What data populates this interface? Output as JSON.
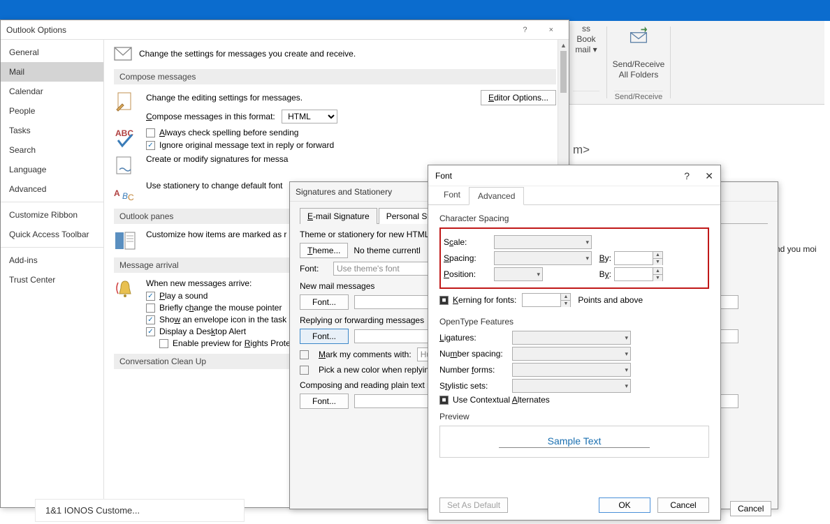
{
  "ribbon": {
    "addr_book": "ss Book",
    "addr_email": "mail ▾",
    "send_receive_top": "Send/Receive",
    "send_receive_bottom": "All Folders",
    "send_receive_group": "Send/Receive"
  },
  "background": {
    "angle_text": "m>",
    "help_q": "?",
    "close_x": "×",
    "truncated": "nd you moi"
  },
  "options": {
    "title": "Outlook Options",
    "nav": [
      "General",
      "Mail",
      "Calendar",
      "People",
      "Tasks",
      "Search",
      "Language",
      "Advanced",
      "Customize Ribbon",
      "Quick Access Toolbar",
      "Add-ins",
      "Trust Center"
    ],
    "header": "Change the settings for messages you create and receive.",
    "sec_compose": "Compose messages",
    "compose_edit": "Change the editing settings for messages.",
    "editor_btn": "Editor Options...",
    "compose_fmt": "Compose messages in this format:",
    "compose_fmt_val": "HTML",
    "chk_spell": "Always check spelling before sending",
    "chk_ignore": "Ignore original message text in reply or forward",
    "sig_text": "Create or modify signatures for messa",
    "stationery_text": "Use stationery to change default font",
    "sec_panes": "Outlook panes",
    "panes_text": "Customize how items are marked as r",
    "sec_arrival": "Message arrival",
    "arrival_head": "When new messages arrive:",
    "arr_sound": "Play a sound",
    "arr_pointer": "Briefly change the mouse pointer",
    "arr_envelope": "Show an envelope icon in the task",
    "arr_desktop": "Display a Desktop Alert",
    "arr_rights": "Enable preview for Rights Prote",
    "sec_convo": "Conversation Clean Up"
  },
  "sig": {
    "title": "Signatures and Stationery",
    "tab1": "E-mail Signature",
    "tab2": "Personal Station",
    "theme_head": "Theme or stationery for new HTML e",
    "theme_btn": "Theme...",
    "theme_none": "No theme currentl",
    "font_lbl": "Font:",
    "font_val": "Use theme's font",
    "new_mail": "New mail messages",
    "font_btn": "Font...",
    "reply_head": "Replying or forwarding messages",
    "mark_comments": "Mark my comments with:",
    "mark_val": "Huy",
    "pick_color": "Pick a new color when replying",
    "plain_head": "Composing and reading plain text m"
  },
  "font": {
    "title": "Font",
    "tab1": "Font",
    "tab2": "Advanced",
    "char_spacing": "Character Spacing",
    "scale": "Scale:",
    "spacing": "Spacing:",
    "position": "Position:",
    "by": "By:",
    "kerning": "Kerning for fonts:",
    "points": "Points and above",
    "opentype": "OpenType Features",
    "ligatures": "Ligatures:",
    "num_spacing": "Number spacing:",
    "num_forms": "Number forms:",
    "stylistic": "Stylistic sets:",
    "contextual": "Use Contextual Alternates",
    "preview_lbl": "Preview",
    "preview_text": "Sample Text",
    "set_default": "Set As Default",
    "ok": "OK",
    "cancel": "Cancel"
  },
  "bottom": {
    "cancel": "Cancel",
    "list_item": "1&1 IONOS Custome..."
  }
}
